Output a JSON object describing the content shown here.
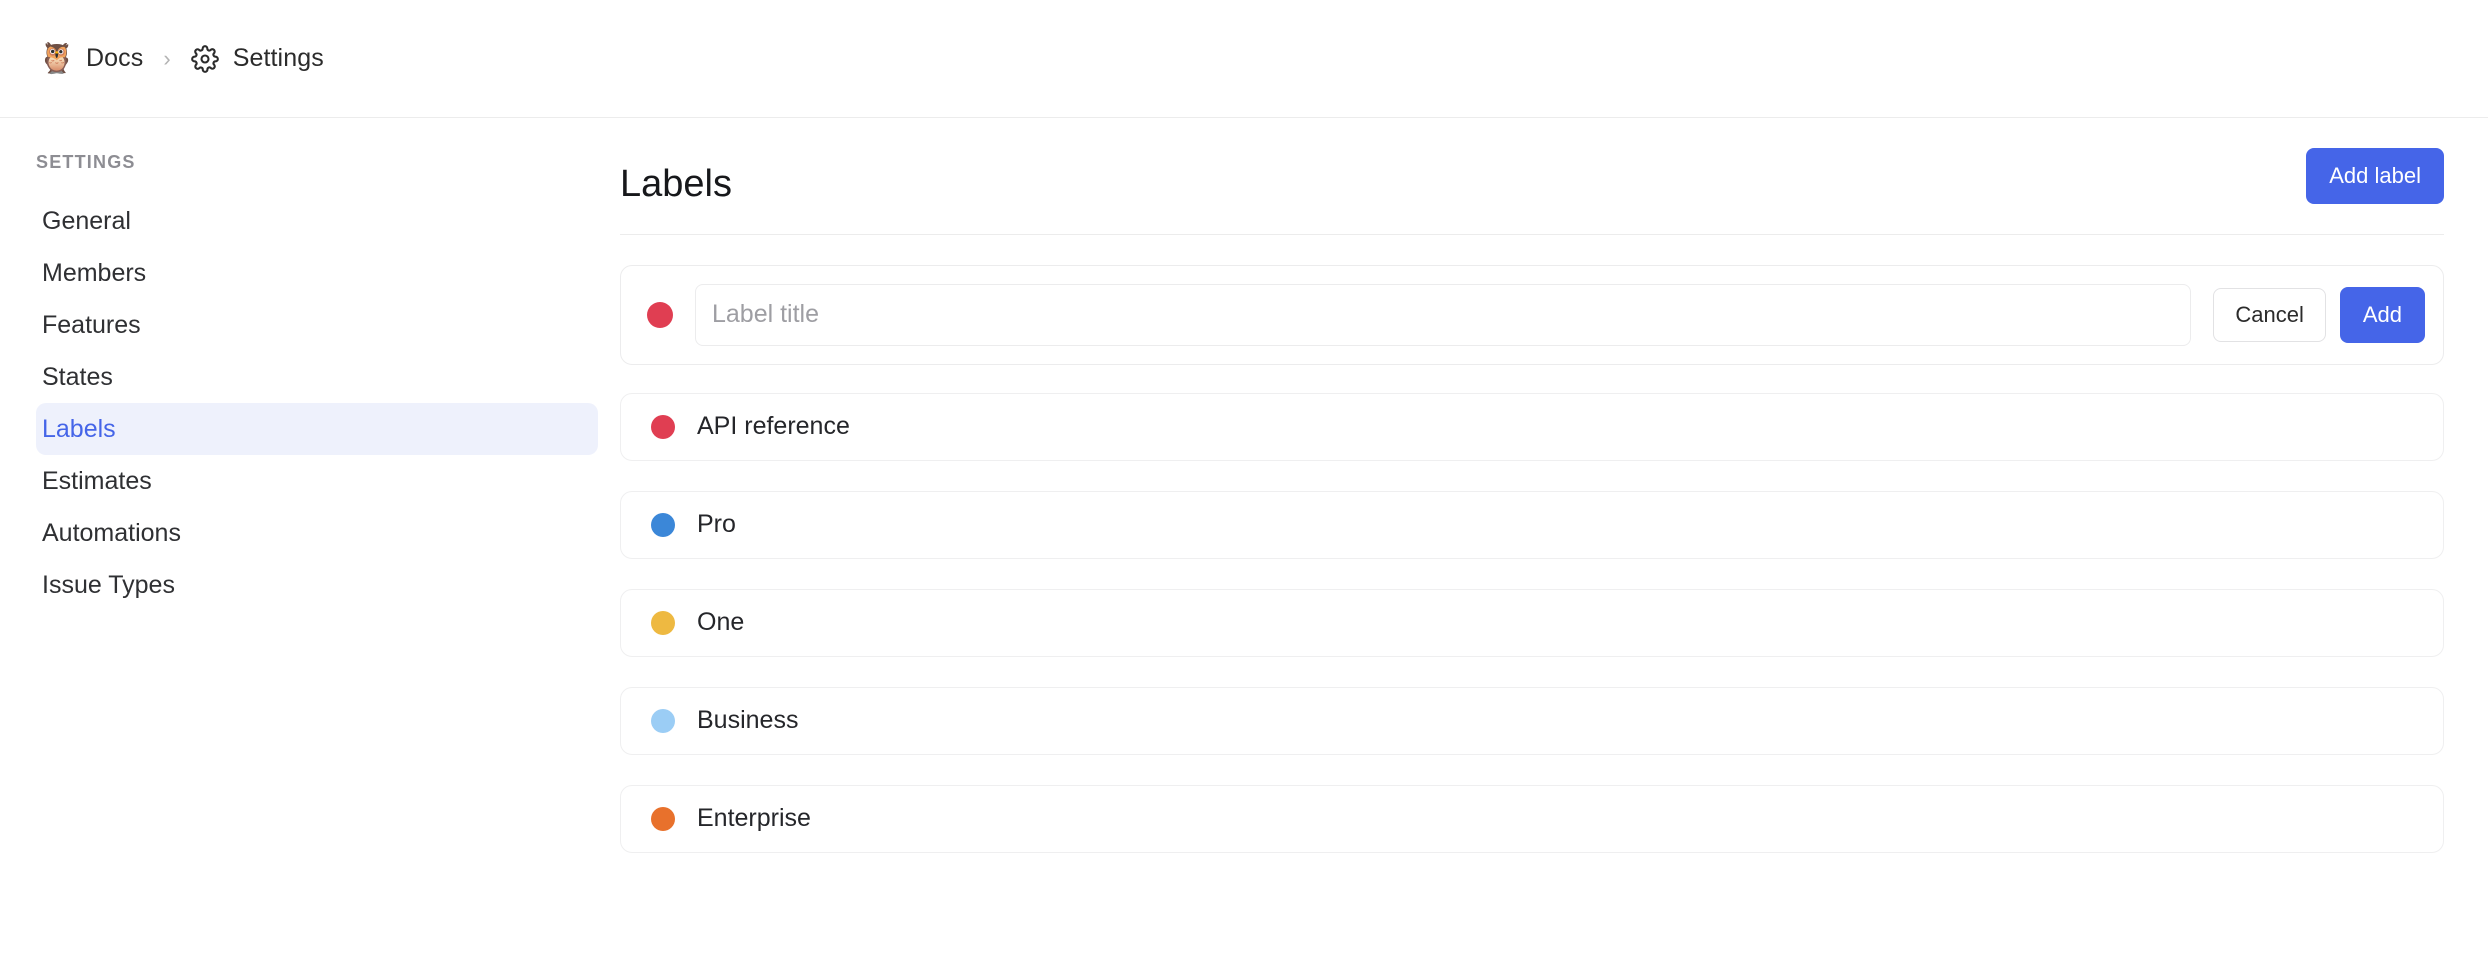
{
  "breadcrumb": {
    "workspace_emoji": "🦉",
    "workspace_name": "Docs",
    "separator": "›",
    "section_icon": "gear-icon",
    "section_name": "Settings"
  },
  "sidebar": {
    "heading": "SETTINGS",
    "items": [
      {
        "label": "General",
        "active": false
      },
      {
        "label": "Members",
        "active": false
      },
      {
        "label": "Features",
        "active": false
      },
      {
        "label": "States",
        "active": false
      },
      {
        "label": "Labels",
        "active": true
      },
      {
        "label": "Estimates",
        "active": false
      },
      {
        "label": "Automations",
        "active": false
      },
      {
        "label": "Issue Types",
        "active": false
      }
    ]
  },
  "main": {
    "title": "Labels",
    "add_label_button": "Add label",
    "create_form": {
      "swatch_color": "#e03e52",
      "input_value": "",
      "input_placeholder": "Label title",
      "cancel_button": "Cancel",
      "add_button": "Add"
    },
    "labels": [
      {
        "name": "API reference",
        "color": "#e03e52"
      },
      {
        "name": "Pro",
        "color": "#3b87d8"
      },
      {
        "name": "One",
        "color": "#eeb941"
      },
      {
        "name": "Business",
        "color": "#9bcdf5"
      },
      {
        "name": "Enterprise",
        "color": "#e8712c"
      }
    ]
  },
  "theme": {
    "accent": "#4565e8",
    "active_nav_bg": "#eef1fc",
    "border": "#ececec"
  }
}
